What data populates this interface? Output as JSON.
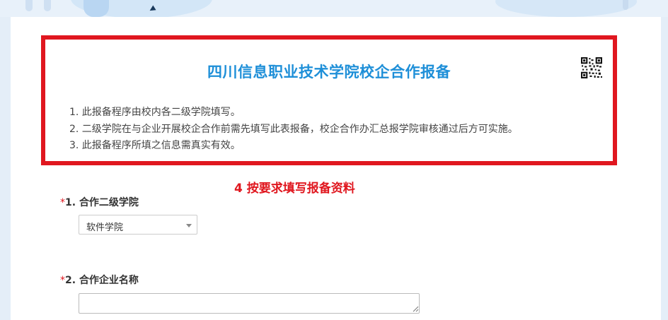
{
  "form": {
    "title": "四川信息职业技术学院校企合作报备",
    "notes": [
      "1. 此报备程序由校内各二级学院填写。",
      "2. 二级学院在与企业开展校企合作前需先填写此表报备，校企合作办汇总报学院审核通过后方可实施。",
      "3. 此报备程序所填之信息需真实有效。"
    ],
    "qr_icon": "qr-code-icon"
  },
  "annotation": "4 按要求填写报备资料",
  "questions": [
    {
      "required_mark": "*",
      "number": "1.",
      "label": "合作二级学院",
      "type": "select",
      "value": "软件学院"
    },
    {
      "required_mark": "*",
      "number": "2.",
      "label": "合作企业名称",
      "type": "textarea",
      "value": ""
    }
  ],
  "colors": {
    "title": "#1e8fd8",
    "highlight_border": "#e0171f",
    "annotation": "#e0171f",
    "required": "#e0171f"
  }
}
